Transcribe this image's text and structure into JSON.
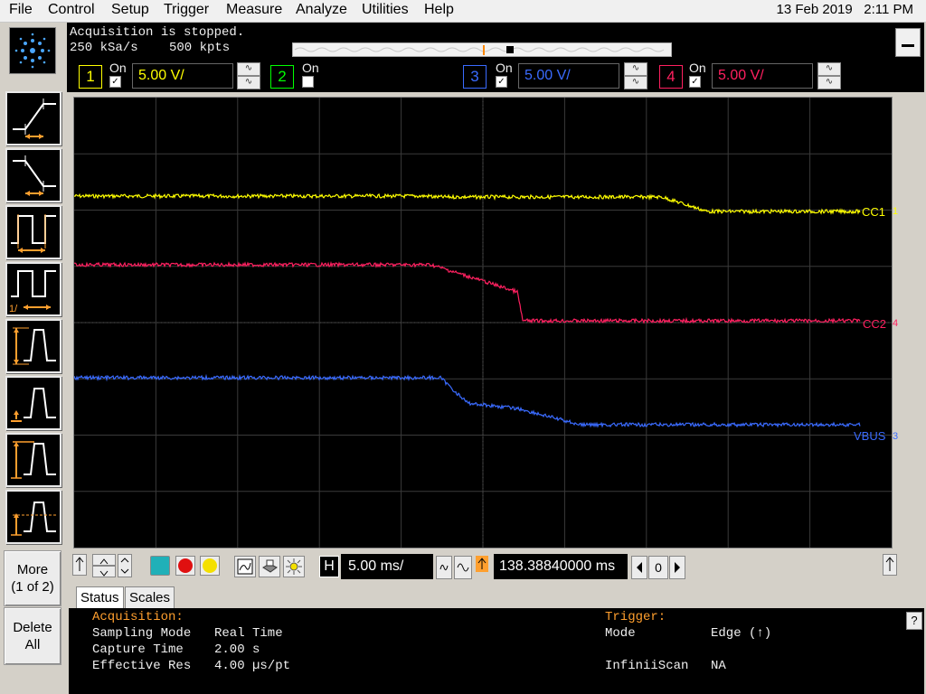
{
  "menu": {
    "items": [
      "File",
      "Control",
      "Setup",
      "Trigger",
      "Measure",
      "Analyze",
      "Utilities",
      "Help"
    ],
    "date": "13 Feb 2019",
    "time": "2:11 PM"
  },
  "acquisition": {
    "status": "Acquisition is stopped.",
    "sample_rate": "250 kSa/s",
    "memory_depth": "500 kpts"
  },
  "channels": [
    {
      "num": "1",
      "on_label": "On",
      "enabled": true,
      "scale": "5.00 V/",
      "color": "#ffff00"
    },
    {
      "num": "2",
      "on_label": "On",
      "enabled": false,
      "scale": "",
      "color": "#00ff00"
    },
    {
      "num": "3",
      "on_label": "On",
      "enabled": true,
      "scale": "5.00 V/",
      "color": "#3a6bff"
    },
    {
      "num": "4",
      "on_label": "On",
      "enabled": true,
      "scale": "5.00 V/",
      "color": "#ff2060"
    }
  ],
  "traces": {
    "cc1": {
      "label": "CC1",
      "ground_marker": "1",
      "color": "#ffff00"
    },
    "cc2": {
      "label": "CC2",
      "ground_marker": "4",
      "color": "#ff2060"
    },
    "vbus": {
      "label": "VBUS",
      "ground_marker": "3",
      "color": "#3a6bff"
    }
  },
  "timebase": {
    "h_label": "H",
    "scale": "5.00 ms/",
    "trigger_time": "138.38840000 ms",
    "delay_value": "0"
  },
  "left_buttons": {
    "more_label": "More",
    "more_page": "(1 of 2)",
    "delete_label": "Delete",
    "delete_sub": "All"
  },
  "tabs": [
    "Status",
    "Scales"
  ],
  "status": {
    "acq_header": "Acquisition:",
    "sampling_mode_label": "Sampling Mode",
    "sampling_mode_value": "Real Time",
    "capture_time_label": "Capture Time",
    "capture_time_value": "2.00 s",
    "eff_res_label": "Effective Res",
    "eff_res_value": "4.00 µs/pt",
    "trigger_header": "Trigger:",
    "mode_label": "Mode",
    "mode_value": "Edge (↑)",
    "infiniiscan_label": "InfiniiScan",
    "infiniiscan_value": "NA",
    "help_icon": "?"
  },
  "icons": {
    "logo": "starburst-logo-icon",
    "minimize": "minimize-icon"
  }
}
